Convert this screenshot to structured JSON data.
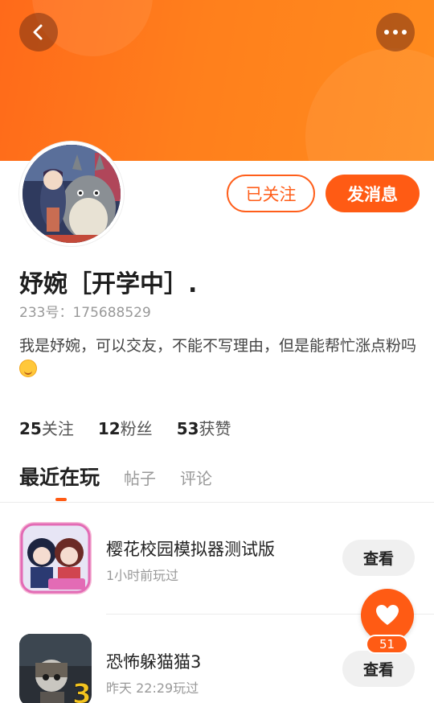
{
  "header": {
    "back_icon": "chevron-left-icon",
    "more_icon": "more-dots-icon",
    "banner_color": "#ff7a1c"
  },
  "profile": {
    "avatar_icon": "avatar-image",
    "nickname": "妤婉［开学中］.",
    "uid_label": "233号：175688529",
    "bio": "我是妤婉，可以交友，不能不写理由，但是能帮忙涨点粉吗",
    "bio_emoji": "smile-emoji-icon",
    "followed_label": "已关注",
    "message_label": "发消息",
    "accent_color": "#ff5b14"
  },
  "stats": [
    {
      "count": "25",
      "label": "关注"
    },
    {
      "count": "12",
      "label": "粉丝"
    },
    {
      "count": "53",
      "label": "获赞"
    }
  ],
  "tabs": [
    {
      "label": "最近在玩",
      "active": true
    },
    {
      "label": "帖子",
      "active": false
    },
    {
      "label": "评论",
      "active": false
    }
  ],
  "games": [
    {
      "name": "樱花校园模拟器测试版",
      "time": "1小时前玩过",
      "button": "查看",
      "icon": "sakura-school-game-icon"
    },
    {
      "name": "恐怖躲猫猫3",
      "time": "昨天 22:29玩过",
      "button": "查看",
      "icon": "horror-hide-seek-game-icon"
    }
  ],
  "like_fab": {
    "icon": "heart-icon",
    "count": "51"
  }
}
